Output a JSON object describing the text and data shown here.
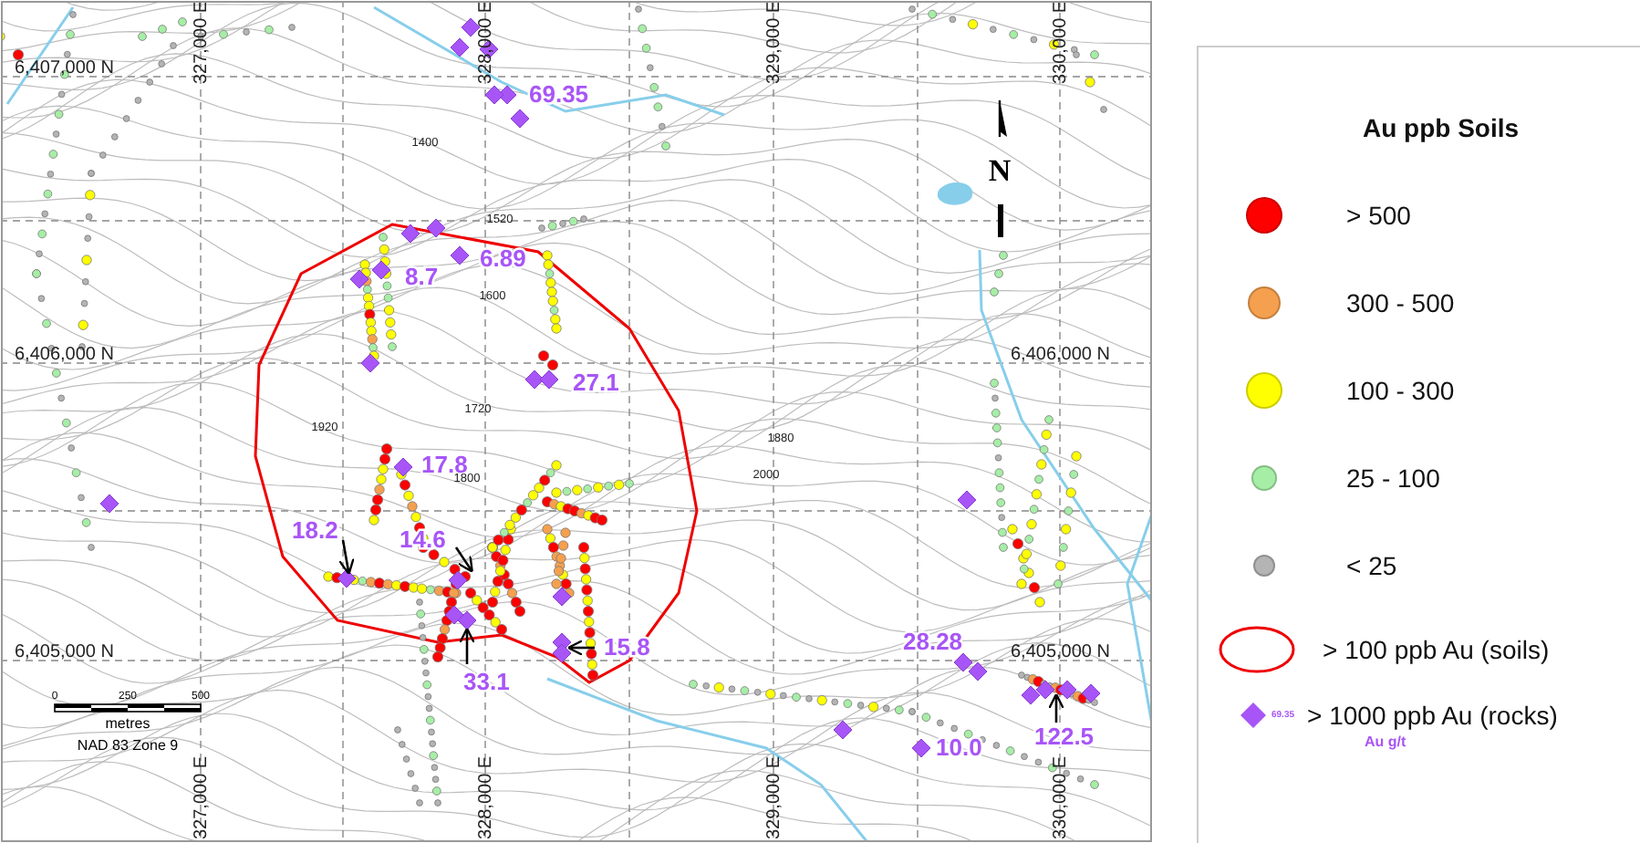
{
  "map": {
    "easting_labels_top": [
      "327,000 E",
      "328,000 E",
      "329,000 E",
      "330,000 E"
    ],
    "easting_labels_bottom": [
      "327,000 E",
      "328,000 E",
      "329,000 E",
      "330,000 E"
    ],
    "northing_labels_left": [
      "6,407,000 N",
      "6,406,000 N",
      "6,405,000 N"
    ],
    "northing_labels_right": [
      "6,406,000 N",
      "6,405,000 N"
    ],
    "contour_labels": [
      "1400",
      "1520",
      "1600",
      "1720",
      "1920",
      "1800",
      "1880",
      "2000"
    ],
    "north_label": "N",
    "scale": {
      "ticks": [
        "0",
        "250",
        "500"
      ],
      "unit": "metres"
    },
    "datum": "NAD 83 Zone 9",
    "rock_samples": [
      {
        "value": "69.35"
      },
      {
        "value": "8.7"
      },
      {
        "value": "6.89"
      },
      {
        "value": "27.1"
      },
      {
        "value": "17.8"
      },
      {
        "value": "18.2"
      },
      {
        "value": "14.6"
      },
      {
        "value": "33.1"
      },
      {
        "value": "15.8"
      },
      {
        "value": "28.28"
      },
      {
        "value": "10.0"
      },
      {
        "value": "122.5"
      }
    ]
  },
  "legend": {
    "title": "Au ppb Soils",
    "soil_classes": [
      {
        "label": "> 500",
        "color": "#ff0000"
      },
      {
        "label": "300 - 500",
        "color": "#f5a04e"
      },
      {
        "label": "100 - 300",
        "color": "#ffff00"
      },
      {
        "label": "25 - 100",
        "color": "#a6eea6"
      },
      {
        "label": "< 25",
        "color": "#b4b4b4"
      }
    ],
    "outline": {
      "label": "> 100 ppb Au (soils)"
    },
    "rock": {
      "sample_value": "69.35",
      "label": "> 1000 ppb Au (rocks)",
      "unit": "Au g/t"
    }
  }
}
